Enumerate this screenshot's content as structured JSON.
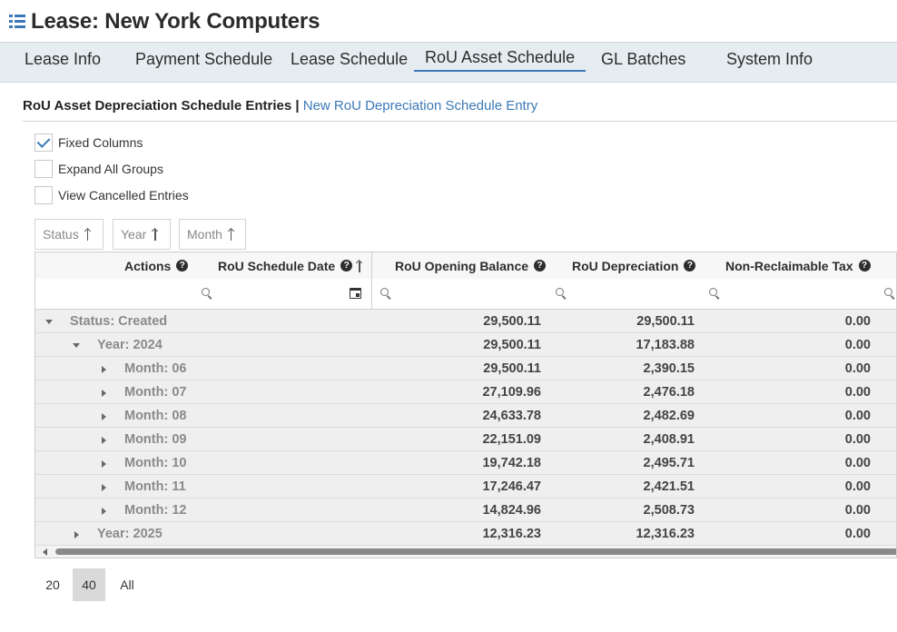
{
  "header": {
    "title": "Lease: New York Computers",
    "icon": "list-icon"
  },
  "tabs": [
    {
      "label": "Lease Info"
    },
    {
      "label": "Payment Schedule"
    },
    {
      "label": "Lease Schedule"
    },
    {
      "label": "RoU Asset Schedule",
      "active": true
    },
    {
      "label": "GL Batches"
    },
    {
      "label": "System Info"
    }
  ],
  "section": {
    "title": "RoU Asset Depreciation Schedule Entries",
    "separator": "|",
    "link": "New RoU Depreciation Schedule Entry"
  },
  "options": [
    {
      "label": "Fixed Columns",
      "checked": true
    },
    {
      "label": "Expand All Groups",
      "checked": false
    },
    {
      "label": "View Cancelled Entries",
      "checked": false
    }
  ],
  "group_chips": [
    {
      "label": "Status"
    },
    {
      "label": "Year"
    },
    {
      "label": "Month"
    }
  ],
  "grid": {
    "columns": [
      {
        "label": "Actions"
      },
      {
        "label": "RoU Schedule Date"
      },
      {
        "label": "RoU Opening Balance"
      },
      {
        "label": "RoU Depreciation"
      },
      {
        "label": "Non-Reclaimable Tax"
      }
    ],
    "rows": [
      {
        "label": "Status: Created",
        "opening": "29,500.11",
        "depreciation": "29,500.11",
        "tax": "0.00"
      },
      {
        "label": "Year: 2024",
        "opening": "29,500.11",
        "depreciation": "17,183.88",
        "tax": "0.00"
      },
      {
        "label": "Month: 06",
        "opening": "29,500.11",
        "depreciation": "2,390.15",
        "tax": "0.00"
      },
      {
        "label": "Month: 07",
        "opening": "27,109.96",
        "depreciation": "2,476.18",
        "tax": "0.00"
      },
      {
        "label": "Month: 08",
        "opening": "24,633.78",
        "depreciation": "2,482.69",
        "tax": "0.00"
      },
      {
        "label": "Month: 09",
        "opening": "22,151.09",
        "depreciation": "2,408.91",
        "tax": "0.00"
      },
      {
        "label": "Month: 10",
        "opening": "19,742.18",
        "depreciation": "2,495.71",
        "tax": "0.00"
      },
      {
        "label": "Month: 11",
        "opening": "17,246.47",
        "depreciation": "2,421.51",
        "tax": "0.00"
      },
      {
        "label": "Month: 12",
        "opening": "14,824.96",
        "depreciation": "2,508.73",
        "tax": "0.00"
      },
      {
        "label": "Year: 2025",
        "opening": "12,316.23",
        "depreciation": "12,316.23",
        "tax": "0.00"
      }
    ]
  },
  "pager": [
    {
      "label": "20"
    },
    {
      "label": "40",
      "active": true
    },
    {
      "label": "All"
    }
  ],
  "colors": {
    "accent": "#3b79b6",
    "tab_bar": "#e6edf0",
    "group_row": "#efefef"
  }
}
